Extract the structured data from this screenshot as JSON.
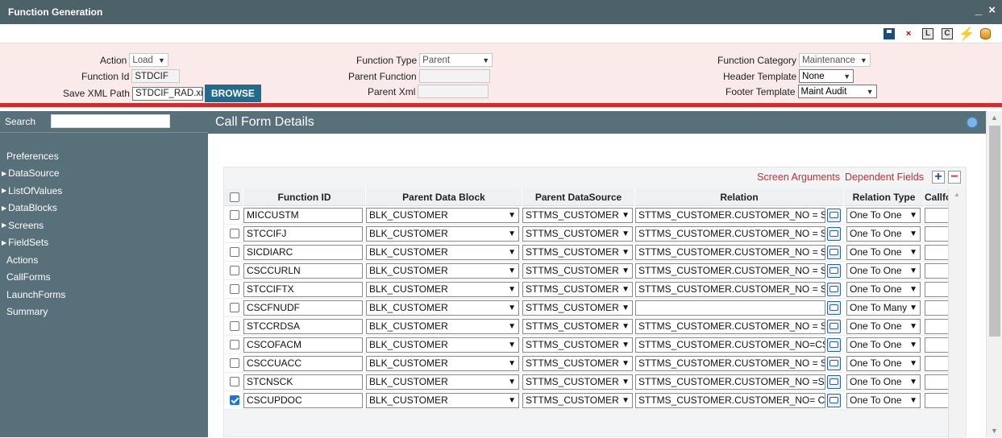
{
  "window": {
    "title": "Function Generation",
    "minimize": "_",
    "close": "×"
  },
  "toolbar": {
    "icons": [
      "save-icon",
      "close-icon",
      "l-icon",
      "c-icon",
      "generate-icon",
      "database-icon"
    ],
    "l_label": "L",
    "c_label": "C",
    "close_glyph": "×",
    "generate_glyph": "⚡"
  },
  "form": {
    "action_label": "Action",
    "action_value": "Load",
    "function_id_label": "Function Id",
    "function_id_value": "STDCIF",
    "save_xml_label": "Save XML Path",
    "save_xml_value": "STDCIF_RAD.xi",
    "browse_label": "BROWSE",
    "function_type_label": "Function Type",
    "function_type_value": "Parent",
    "parent_function_label": "Parent Function",
    "parent_function_value": "",
    "parent_xml_label": "Parent Xml",
    "parent_xml_value": "",
    "function_category_label": "Function Category",
    "function_category_value": "Maintenance",
    "header_template_label": "Header Template",
    "header_template_value": "None",
    "footer_template_label": "Footer Template",
    "footer_template_value": "Maint Audit"
  },
  "sidebar": {
    "search_label": "Search",
    "search_value": "",
    "items": [
      {
        "label": "Preferences",
        "tree": false
      },
      {
        "label": "DataSource",
        "tree": true
      },
      {
        "label": "ListOfValues",
        "tree": true
      },
      {
        "label": "DataBlocks",
        "tree": true
      },
      {
        "label": "Screens",
        "tree": true
      },
      {
        "label": "FieldSets",
        "tree": true
      },
      {
        "label": "Actions",
        "tree": false
      },
      {
        "label": "CallForms",
        "tree": false
      },
      {
        "label": "LaunchForms",
        "tree": false
      },
      {
        "label": "Summary",
        "tree": false
      }
    ]
  },
  "main": {
    "title": "Call Form Details",
    "screen_arguments": "Screen Arguments",
    "dependent_fields": "Dependent Fields",
    "add_glyph": "+",
    "remove_glyph": "−",
    "columns": [
      "Function ID",
      "Parent Data Block",
      "Parent DataSource",
      "Relation",
      "Relation Type",
      "Callfo"
    ],
    "rows": [
      {
        "checked": false,
        "function_id": "MICCUSTM",
        "parent_block": "BLK_CUSTOMER",
        "parent_ds": "STTMS_CUSTOMER",
        "relation": "STTMS_CUSTOMER.CUSTOMER_NO = ST",
        "relation_type": "One To One"
      },
      {
        "checked": false,
        "function_id": "STCCIFJ",
        "parent_block": "BLK_CUSTOMER",
        "parent_ds": "STTMS_CUSTOMER",
        "relation": "STTMS_CUSTOMER.CUSTOMER_NO = ST",
        "relation_type": "One To One"
      },
      {
        "checked": false,
        "function_id": "SICDIARC",
        "parent_block": "BLK_CUSTOMER",
        "parent_ds": "STTMS_CUSTOMER",
        "relation": "STTMS_CUSTOMER.CUSTOMER_NO = ST",
        "relation_type": "One To One"
      },
      {
        "checked": false,
        "function_id": "CSCCURLN",
        "parent_block": "BLK_CUSTOMER",
        "parent_ds": "STTMS_CUSTOMER",
        "relation": "STTMS_CUSTOMER.CUSTOMER_NO = ST",
        "relation_type": "One To One"
      },
      {
        "checked": false,
        "function_id": "STCCIFTX",
        "parent_block": "BLK_CUSTOMER",
        "parent_ds": "STTMS_CUSTOMER",
        "relation": "STTMS_CUSTOMER.CUSTOMER_NO = ST",
        "relation_type": "One To One"
      },
      {
        "checked": false,
        "function_id": "CSCFNUDF",
        "parent_block": "BLK_CUSTOMER",
        "parent_ds": "STTMS_CUSTOMER",
        "relation": "",
        "relation_type": "One To Many"
      },
      {
        "checked": false,
        "function_id": "STCCRDSA",
        "parent_block": "BLK_CUSTOMER",
        "parent_ds": "STTMS_CUSTOMER",
        "relation": "STTMS_CUSTOMER.CUSTOMER_NO = ST",
        "relation_type": "One To One"
      },
      {
        "checked": false,
        "function_id": "CSCOFACM",
        "parent_block": "BLK_CUSTOMER",
        "parent_ds": "STTMS_CUSTOMER",
        "relation": "STTMS_CUSTOMER.CUSTOMER_NO=CS",
        "relation_type": "One To One"
      },
      {
        "checked": false,
        "function_id": "CSCCUACC",
        "parent_block": "BLK_CUSTOMER",
        "parent_ds": "STTMS_CUSTOMER",
        "relation": "STTMS_CUSTOMER.CUSTOMER_NO = ST",
        "relation_type": "One To One"
      },
      {
        "checked": false,
        "function_id": "STCNSCK",
        "parent_block": "BLK_CUSTOMER",
        "parent_ds": "STTMS_CUSTOMER",
        "relation": "STTMS_CUSTOMER.CUSTOMER_NO =ST",
        "relation_type": "One To One"
      },
      {
        "checked": true,
        "function_id": "CSCUPDOC",
        "parent_block": "BLK_CUSTOMER",
        "parent_ds": "STTMS_CUSTOMER",
        "relation": "STTMS_CUSTOMER.CUSTOMER_NO= CS",
        "relation_type": "One To One"
      }
    ]
  }
}
